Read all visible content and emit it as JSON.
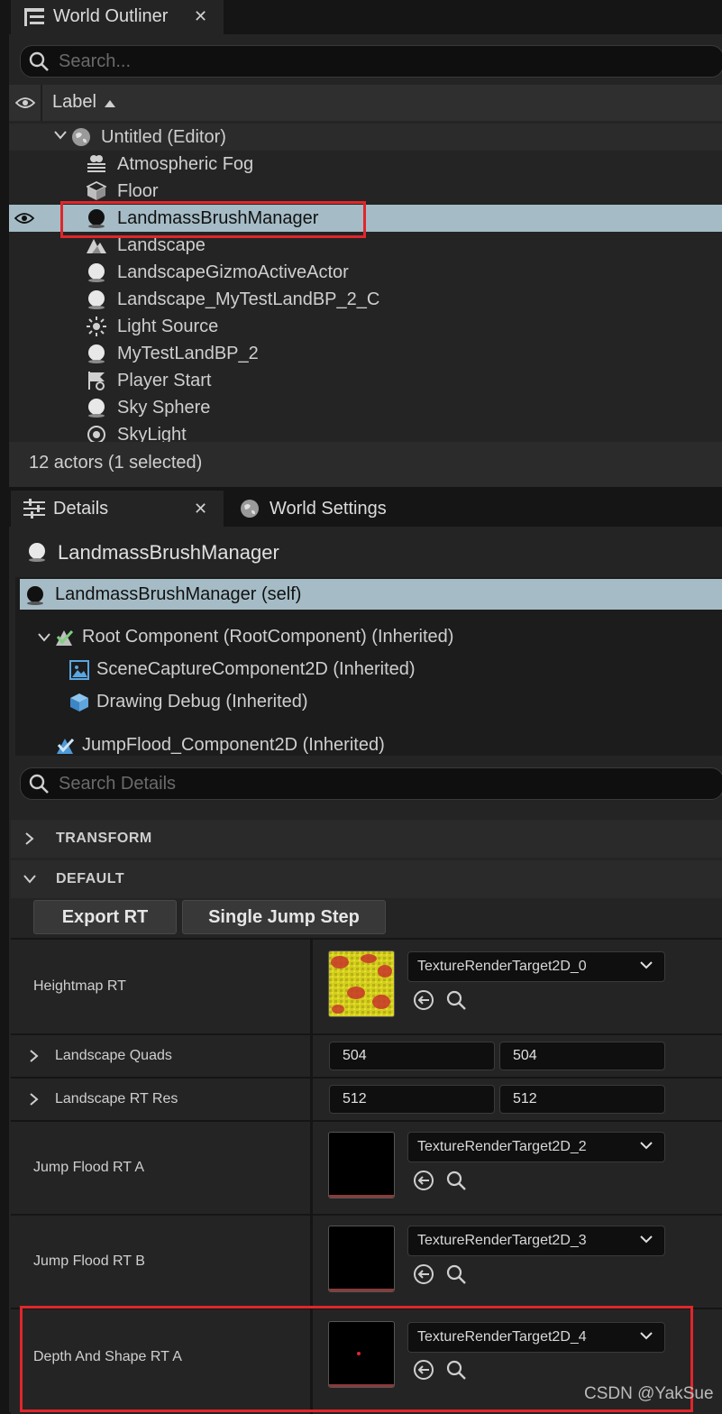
{
  "outliner": {
    "tab_title": "World Outliner",
    "search_placeholder": "Search...",
    "column_label": "Label",
    "world": "Untitled (Editor)",
    "actors": [
      {
        "label": "Atmospheric Fog",
        "icon": "fog-icon"
      },
      {
        "label": "Floor",
        "icon": "cube-icon"
      },
      {
        "label": "LandmassBrushManager",
        "icon": "sphere-icon",
        "selected": true
      },
      {
        "label": "Landscape",
        "icon": "landscape-icon"
      },
      {
        "label": "LandscapeGizmoActiveActor",
        "icon": "sphere-icon"
      },
      {
        "label": "Landscape_MyTestLandBP_2_C",
        "icon": "sphere-icon"
      },
      {
        "label": "Light Source",
        "icon": "sun-icon"
      },
      {
        "label": "MyTestLandBP_2",
        "icon": "sphere-icon"
      },
      {
        "label": "Player Start",
        "icon": "flag-icon"
      },
      {
        "label": "Sky Sphere",
        "icon": "sphere-icon"
      },
      {
        "label": "SkyLight",
        "icon": "skylight-icon"
      }
    ],
    "status": "12 actors (1 selected)"
  },
  "details": {
    "tab_title": "Details",
    "world_settings_tab": "World Settings",
    "actor_name": "LandmassBrushManager",
    "components": {
      "self": "LandmassBrushManager (self)",
      "root": "Root Component (RootComponent) (Inherited)",
      "scene_capture": "SceneCaptureComponent2D (Inherited)",
      "drawing_debug": "Drawing Debug (Inherited)",
      "jump_flood": "JumpFlood_Component2D (Inherited)"
    },
    "search_placeholder": "Search Details",
    "sections": {
      "transform": "TRANSFORM",
      "default": "DEFAULT"
    },
    "buttons": {
      "export_rt": "Export RT",
      "single_jump": "Single Jump Step"
    },
    "properties": {
      "heightmap_rt": {
        "label": "Heightmap RT",
        "value": "TextureRenderTarget2D_0"
      },
      "landscape_quads": {
        "label": "Landscape Quads",
        "x": "504",
        "y": "504"
      },
      "landscape_rt_res": {
        "label": "Landscape RT Res",
        "x": "512",
        "y": "512"
      },
      "jump_flood_rt_a": {
        "label": "Jump Flood RT A",
        "value": "TextureRenderTarget2D_2"
      },
      "jump_flood_rt_b": {
        "label": "Jump Flood RT B",
        "value": "TextureRenderTarget2D_3"
      },
      "depth_shape_rt_a": {
        "label": "Depth And Shape RT A",
        "value": "TextureRenderTarget2D_4"
      }
    }
  },
  "watermark": "CSDN @YakSue",
  "colors": {
    "selection": "#a5bcc6",
    "highlight_box": "#e0262b"
  }
}
